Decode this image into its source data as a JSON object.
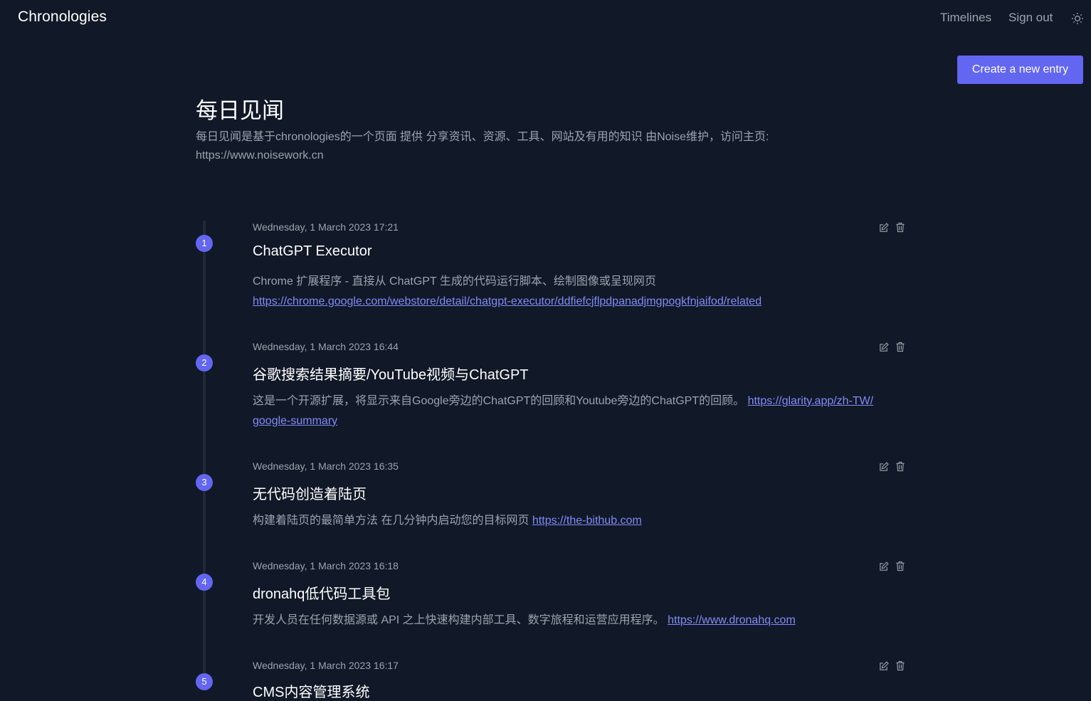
{
  "header": {
    "brand": "Chronologies",
    "nav": {
      "timelines": "Timelines",
      "sign_out": "Sign out"
    },
    "theme_icon": "sun-icon"
  },
  "actions": {
    "create_entry": "Create a new entry"
  },
  "timeline": {
    "title": "每日见闻",
    "description": "每日见闻是基于chronologies的一个页面 提供 分享资讯、资源、工具、网站及有用的知识 由Noise维护，访问主页: https://www.noisework.cn"
  },
  "entries": [
    {
      "number": "1",
      "date": "Wednesday, 1 March 2023 17:21",
      "title": "ChatGPT Executor",
      "text": "Chrome 扩展程序 - 直接从 ChatGPT 生成的代码运行脚本、绘制图像或呈现网页",
      "link": "https://chrome.google.com/webstore/detail/chatgpt-executor/ddfiefcjflpdpanadjmgpogkfnjaifod/related"
    },
    {
      "number": "2",
      "date": "Wednesday, 1 March 2023 16:44",
      "title": "谷歌搜索结果摘要/YouTube视频与ChatGPT",
      "text": "这是一个开源扩展，将显示来自Google旁边的ChatGPT的回顾和Youtube旁边的ChatGPT的回顾。",
      "link": "https://glarity.app/zh-TW/google-summary"
    },
    {
      "number": "3",
      "date": "Wednesday, 1 March 2023 16:35",
      "title": "无代码创造着陆页",
      "text": "构建着陆页的最简单方法 在几分钟内启动您的目标网页",
      "link": "https://the-bithub.com"
    },
    {
      "number": "4",
      "date": "Wednesday, 1 March 2023 16:18",
      "title": "dronahq低代码工具包",
      "text": "开发人员在任何数据源或 API 之上快速构建内部工具、数字旅程和运营应用程序。",
      "link": "https://www.dronahq.com"
    },
    {
      "number": "5",
      "date": "Wednesday, 1 March 2023 16:17",
      "title": "CMS内容管理系统",
      "text": "",
      "link": ""
    }
  ],
  "entry_actions": {
    "edit_icon": "edit-icon",
    "delete_icon": "trash-icon"
  },
  "colors": {
    "background": "#111827",
    "accent": "#6366f1",
    "link": "#818cf8",
    "muted_text": "#9ca3af"
  }
}
